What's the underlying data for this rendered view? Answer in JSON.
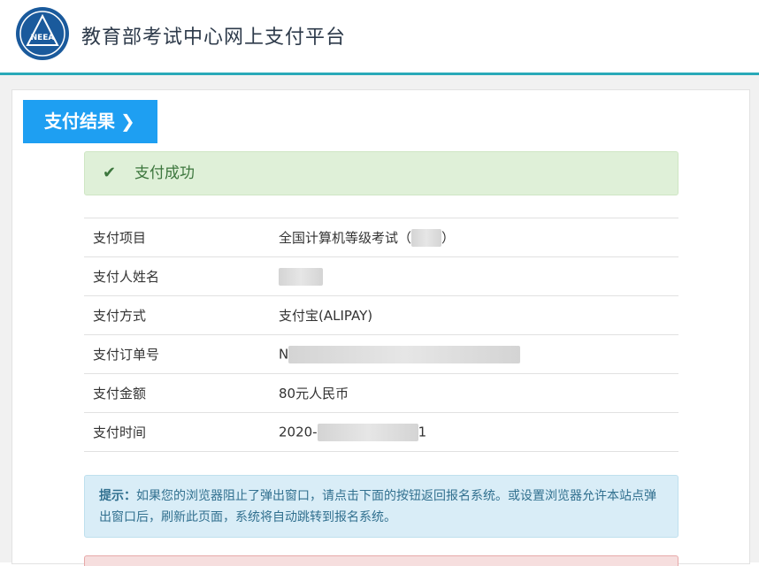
{
  "header": {
    "logo_text": "NEEA",
    "title": "教育部考试中心网上支付平台"
  },
  "result_tab": {
    "label": "支付结果",
    "chevron_icon": "chevron-right-icon"
  },
  "success": {
    "icon": "check-icon",
    "text": "支付成功"
  },
  "payment_info": [
    {
      "label": "支付项目",
      "value": "全国计算机等级考试（",
      "value_suffix": "）"
    },
    {
      "label": "支付人姓名",
      "value": ""
    },
    {
      "label": "支付方式",
      "value": "支付宝(ALIPAY)"
    },
    {
      "label": "支付订单号",
      "value": "N",
      "value_suffix": ""
    },
    {
      "label": "支付金额",
      "value": "80元人民币"
    },
    {
      "label": "支付时间",
      "value": "2020-",
      "value_suffix": "1"
    }
  ],
  "notice": {
    "prefix": "提示：",
    "text": "如果您的浏览器阻止了弹出窗口，请点击下面的按钮返回报名系统。或设置浏览器允许本站点弹出窗口后，刷新此页面，系统将自动跳转到报名系统。"
  },
  "colors": {
    "accent_blue": "#1e9ff2",
    "header_rule": "#29a9b8",
    "success_bg": "#dff0d8",
    "success_text": "#3c763d",
    "info_bg": "#d9edf7",
    "info_text": "#31708f"
  }
}
